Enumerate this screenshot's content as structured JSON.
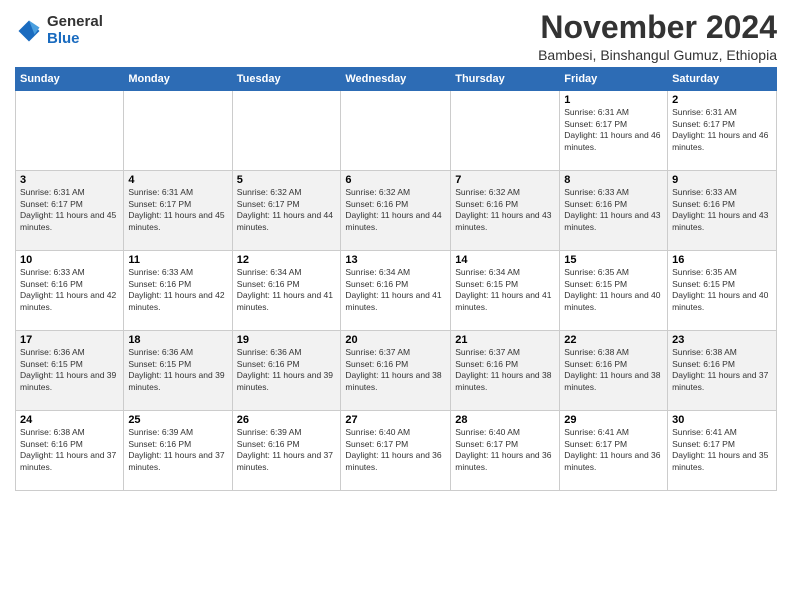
{
  "logo": {
    "general": "General",
    "blue": "Blue"
  },
  "header": {
    "month": "November 2024",
    "location": "Bambesi, Binshangul Gumuz, Ethiopia"
  },
  "weekdays": [
    "Sunday",
    "Monday",
    "Tuesday",
    "Wednesday",
    "Thursday",
    "Friday",
    "Saturday"
  ],
  "weeks": [
    [
      {
        "day": "",
        "sunrise": "",
        "sunset": "",
        "daylight": ""
      },
      {
        "day": "",
        "sunrise": "",
        "sunset": "",
        "daylight": ""
      },
      {
        "day": "",
        "sunrise": "",
        "sunset": "",
        "daylight": ""
      },
      {
        "day": "",
        "sunrise": "",
        "sunset": "",
        "daylight": ""
      },
      {
        "day": "",
        "sunrise": "",
        "sunset": "",
        "daylight": ""
      },
      {
        "day": "1",
        "sunrise": "Sunrise: 6:31 AM",
        "sunset": "Sunset: 6:17 PM",
        "daylight": "Daylight: 11 hours and 46 minutes."
      },
      {
        "day": "2",
        "sunrise": "Sunrise: 6:31 AM",
        "sunset": "Sunset: 6:17 PM",
        "daylight": "Daylight: 11 hours and 46 minutes."
      }
    ],
    [
      {
        "day": "3",
        "sunrise": "Sunrise: 6:31 AM",
        "sunset": "Sunset: 6:17 PM",
        "daylight": "Daylight: 11 hours and 45 minutes."
      },
      {
        "day": "4",
        "sunrise": "Sunrise: 6:31 AM",
        "sunset": "Sunset: 6:17 PM",
        "daylight": "Daylight: 11 hours and 45 minutes."
      },
      {
        "day": "5",
        "sunrise": "Sunrise: 6:32 AM",
        "sunset": "Sunset: 6:17 PM",
        "daylight": "Daylight: 11 hours and 44 minutes."
      },
      {
        "day": "6",
        "sunrise": "Sunrise: 6:32 AM",
        "sunset": "Sunset: 6:16 PM",
        "daylight": "Daylight: 11 hours and 44 minutes."
      },
      {
        "day": "7",
        "sunrise": "Sunrise: 6:32 AM",
        "sunset": "Sunset: 6:16 PM",
        "daylight": "Daylight: 11 hours and 43 minutes."
      },
      {
        "day": "8",
        "sunrise": "Sunrise: 6:33 AM",
        "sunset": "Sunset: 6:16 PM",
        "daylight": "Daylight: 11 hours and 43 minutes."
      },
      {
        "day": "9",
        "sunrise": "Sunrise: 6:33 AM",
        "sunset": "Sunset: 6:16 PM",
        "daylight": "Daylight: 11 hours and 43 minutes."
      }
    ],
    [
      {
        "day": "10",
        "sunrise": "Sunrise: 6:33 AM",
        "sunset": "Sunset: 6:16 PM",
        "daylight": "Daylight: 11 hours and 42 minutes."
      },
      {
        "day": "11",
        "sunrise": "Sunrise: 6:33 AM",
        "sunset": "Sunset: 6:16 PM",
        "daylight": "Daylight: 11 hours and 42 minutes."
      },
      {
        "day": "12",
        "sunrise": "Sunrise: 6:34 AM",
        "sunset": "Sunset: 6:16 PM",
        "daylight": "Daylight: 11 hours and 41 minutes."
      },
      {
        "day": "13",
        "sunrise": "Sunrise: 6:34 AM",
        "sunset": "Sunset: 6:16 PM",
        "daylight": "Daylight: 11 hours and 41 minutes."
      },
      {
        "day": "14",
        "sunrise": "Sunrise: 6:34 AM",
        "sunset": "Sunset: 6:15 PM",
        "daylight": "Daylight: 11 hours and 41 minutes."
      },
      {
        "day": "15",
        "sunrise": "Sunrise: 6:35 AM",
        "sunset": "Sunset: 6:15 PM",
        "daylight": "Daylight: 11 hours and 40 minutes."
      },
      {
        "day": "16",
        "sunrise": "Sunrise: 6:35 AM",
        "sunset": "Sunset: 6:15 PM",
        "daylight": "Daylight: 11 hours and 40 minutes."
      }
    ],
    [
      {
        "day": "17",
        "sunrise": "Sunrise: 6:36 AM",
        "sunset": "Sunset: 6:15 PM",
        "daylight": "Daylight: 11 hours and 39 minutes."
      },
      {
        "day": "18",
        "sunrise": "Sunrise: 6:36 AM",
        "sunset": "Sunset: 6:15 PM",
        "daylight": "Daylight: 11 hours and 39 minutes."
      },
      {
        "day": "19",
        "sunrise": "Sunrise: 6:36 AM",
        "sunset": "Sunset: 6:16 PM",
        "daylight": "Daylight: 11 hours and 39 minutes."
      },
      {
        "day": "20",
        "sunrise": "Sunrise: 6:37 AM",
        "sunset": "Sunset: 6:16 PM",
        "daylight": "Daylight: 11 hours and 38 minutes."
      },
      {
        "day": "21",
        "sunrise": "Sunrise: 6:37 AM",
        "sunset": "Sunset: 6:16 PM",
        "daylight": "Daylight: 11 hours and 38 minutes."
      },
      {
        "day": "22",
        "sunrise": "Sunrise: 6:38 AM",
        "sunset": "Sunset: 6:16 PM",
        "daylight": "Daylight: 11 hours and 38 minutes."
      },
      {
        "day": "23",
        "sunrise": "Sunrise: 6:38 AM",
        "sunset": "Sunset: 6:16 PM",
        "daylight": "Daylight: 11 hours and 37 minutes."
      }
    ],
    [
      {
        "day": "24",
        "sunrise": "Sunrise: 6:38 AM",
        "sunset": "Sunset: 6:16 PM",
        "daylight": "Daylight: 11 hours and 37 minutes."
      },
      {
        "day": "25",
        "sunrise": "Sunrise: 6:39 AM",
        "sunset": "Sunset: 6:16 PM",
        "daylight": "Daylight: 11 hours and 37 minutes."
      },
      {
        "day": "26",
        "sunrise": "Sunrise: 6:39 AM",
        "sunset": "Sunset: 6:16 PM",
        "daylight": "Daylight: 11 hours and 37 minutes."
      },
      {
        "day": "27",
        "sunrise": "Sunrise: 6:40 AM",
        "sunset": "Sunset: 6:17 PM",
        "daylight": "Daylight: 11 hours and 36 minutes."
      },
      {
        "day": "28",
        "sunrise": "Sunrise: 6:40 AM",
        "sunset": "Sunset: 6:17 PM",
        "daylight": "Daylight: 11 hours and 36 minutes."
      },
      {
        "day": "29",
        "sunrise": "Sunrise: 6:41 AM",
        "sunset": "Sunset: 6:17 PM",
        "daylight": "Daylight: 11 hours and 36 minutes."
      },
      {
        "day": "30",
        "sunrise": "Sunrise: 6:41 AM",
        "sunset": "Sunset: 6:17 PM",
        "daylight": "Daylight: 11 hours and 35 minutes."
      }
    ]
  ]
}
